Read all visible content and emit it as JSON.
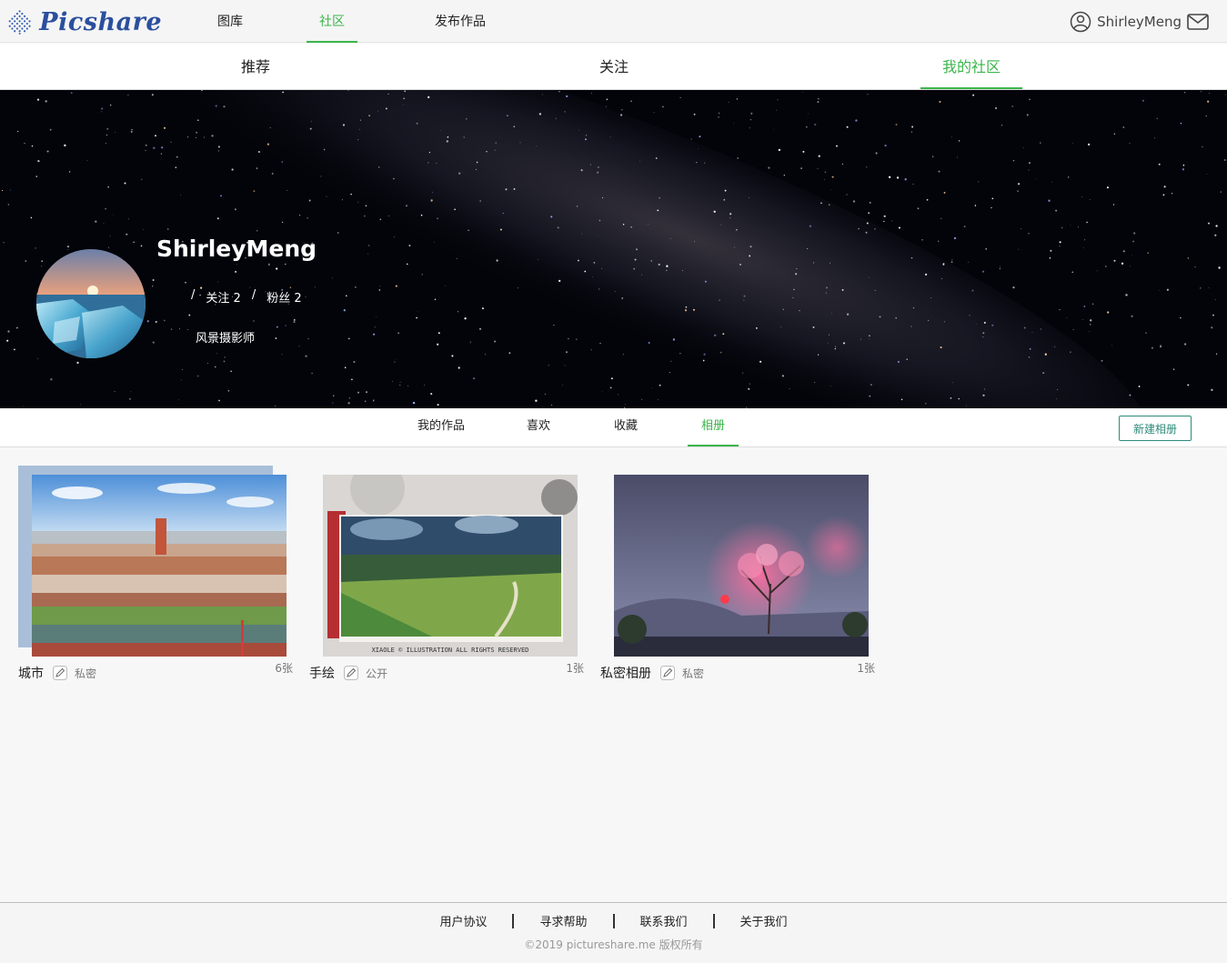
{
  "brand": {
    "name": "Picshare"
  },
  "topnav": {
    "items": [
      "图库",
      "社区",
      "发布作品"
    ],
    "active": "社区"
  },
  "user": {
    "name": "ShirleyMeng"
  },
  "subnav": {
    "items": [
      "推荐",
      "关注",
      "我的社区"
    ],
    "active": "我的社区"
  },
  "profile": {
    "name": "ShirleyMeng",
    "following_label": "关注",
    "following_count": "2",
    "followers_label": "粉丝",
    "followers_count": "2",
    "bio": "风景摄影师"
  },
  "tabs": {
    "items": [
      "我的作品",
      "喜欢",
      "收藏",
      "相册"
    ],
    "active": "相册",
    "new_album": "新建相册"
  },
  "albums": [
    {
      "title": "城市",
      "privacy": "私密",
      "count": "6张"
    },
    {
      "title": "手绘",
      "privacy": "公开",
      "count": "1张"
    },
    {
      "title": "私密相册",
      "privacy": "私密",
      "count": "1张"
    }
  ],
  "footer": {
    "links": [
      "用户协议",
      "寻求帮助",
      "联系我们",
      "关于我们"
    ],
    "copyright": "©2019 pictureshare.me 版权所有"
  },
  "colors": {
    "accent": "#3bb54a",
    "brand": "#2b4f9e",
    "button": "#2e8b7a"
  }
}
